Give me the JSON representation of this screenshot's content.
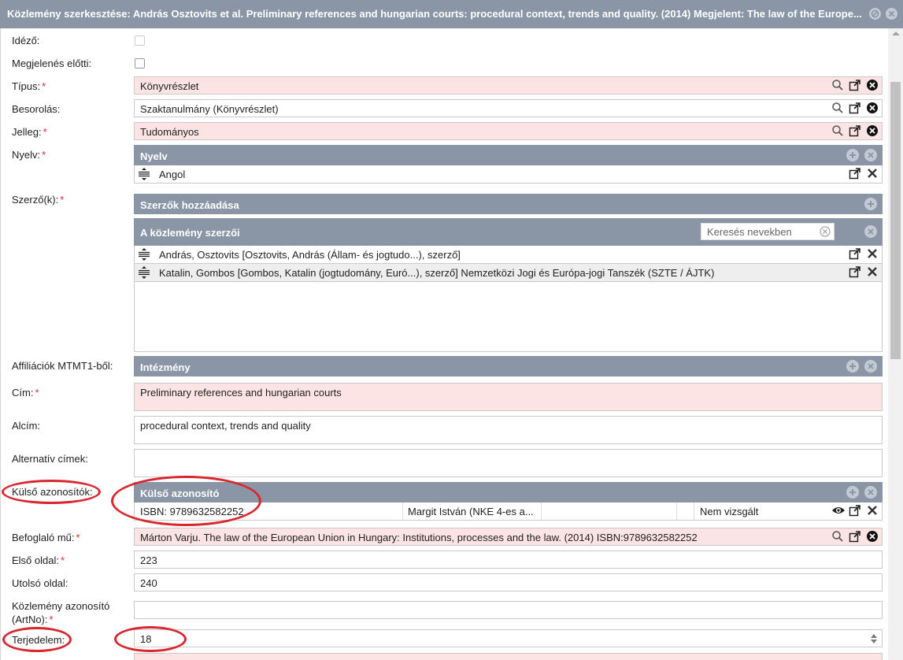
{
  "window": {
    "title": "Közlemény szerkesztése: András Osztovits et al. Preliminary references and hungarian courts: procedural context, trends and quality. (2014) Megjelent: The law of the Europe..."
  },
  "labels": {
    "idezo": "Idéző:",
    "megjelenes_elotti": "Megjelenés előtti:",
    "tipus": "Típus:",
    "besorolas": "Besorolás:",
    "jelleg": "Jelleg:",
    "nyelv": "Nyelv:",
    "szerzok": "Szerző(k):",
    "affiliaciok": "Affiliációk MTMT1-ből:",
    "cim": "Cím:",
    "alcim": "Alcím:",
    "alternativ_cimek": "Alternatív címek:",
    "kulso_azonositok": "Külső azonosítók:",
    "befoglalo_mu": "Befoglaló mű:",
    "elso_oldal": "Első oldal:",
    "utolso_oldal": "Utolsó oldal:",
    "kozlemeny_azonosito_1": "Közlemény azonosító",
    "kozlemeny_azonosito_2": "(ArtNo):",
    "terjedelem": "Terjedelem:",
    "required_mark": "*"
  },
  "fields": {
    "tipus": "Könyvrészlet",
    "besorolas": "Szaktanulmány (Könyvrészlet)",
    "jelleg": "Tudományos",
    "cim": "Preliminary references and hungarian courts",
    "alcim": "procedural context, trends and quality",
    "alternativ_cimek": "",
    "befoglalo_mu": "Márton Varju. The law of the European Union in Hungary: Institutions, processes and the law. (2014) ISBN:9789632582252",
    "elso_oldal": "223",
    "utolso_oldal": "240",
    "kozlemeny_azonosito": "",
    "terjedelem": "18"
  },
  "panels": {
    "nyelv": {
      "header": "Nyelv",
      "rows": [
        "Angol"
      ]
    },
    "szerzok_hozzaadasa": {
      "header": "Szerzők hozzáadása"
    },
    "kozlemeny_szerzoi": {
      "header": "A közlemény szerzői",
      "search_placeholder": "Keresés nevekben",
      "rows": [
        "András, Osztovits [Osztovits, András (Állam- és jogtudo...), szerző]",
        "Katalin, Gombos [Gombos, Katalin (jogtudomány, Euró...), szerző] Nemzetközi Jogi és Európa-jogi Tanszék (SZTE / ÁJTK)"
      ]
    },
    "intezmeny": {
      "header": "Intézmény"
    },
    "kulso_azonosito": {
      "header": "Külső azonosító",
      "row": {
        "id": "ISBN: 9789632582252",
        "creator": "Margit István (NKE 4-es a...",
        "extra": "",
        "status": "Nem vizsgált"
      }
    }
  },
  "checkboxes": {
    "idezo": false,
    "megjelenes_elotti": false
  },
  "colors": {
    "header_bg": "#8a96a6",
    "required_bg": "#fce4e4",
    "required_mark": "#d9262f",
    "annotation": "#d9262f"
  },
  "icons": {
    "close_window": "close-circle-icon",
    "minimize_window": "block-icon",
    "search": "search-icon",
    "open_external": "external-link-icon",
    "clear": "clear-circle-icon",
    "add": "plus-circle-icon",
    "remove": "x-circle-icon",
    "delete_row": "x-icon",
    "drag": "drag-handle-icon",
    "view": "eye-icon",
    "stepper": "stepper-arrows-icon"
  }
}
